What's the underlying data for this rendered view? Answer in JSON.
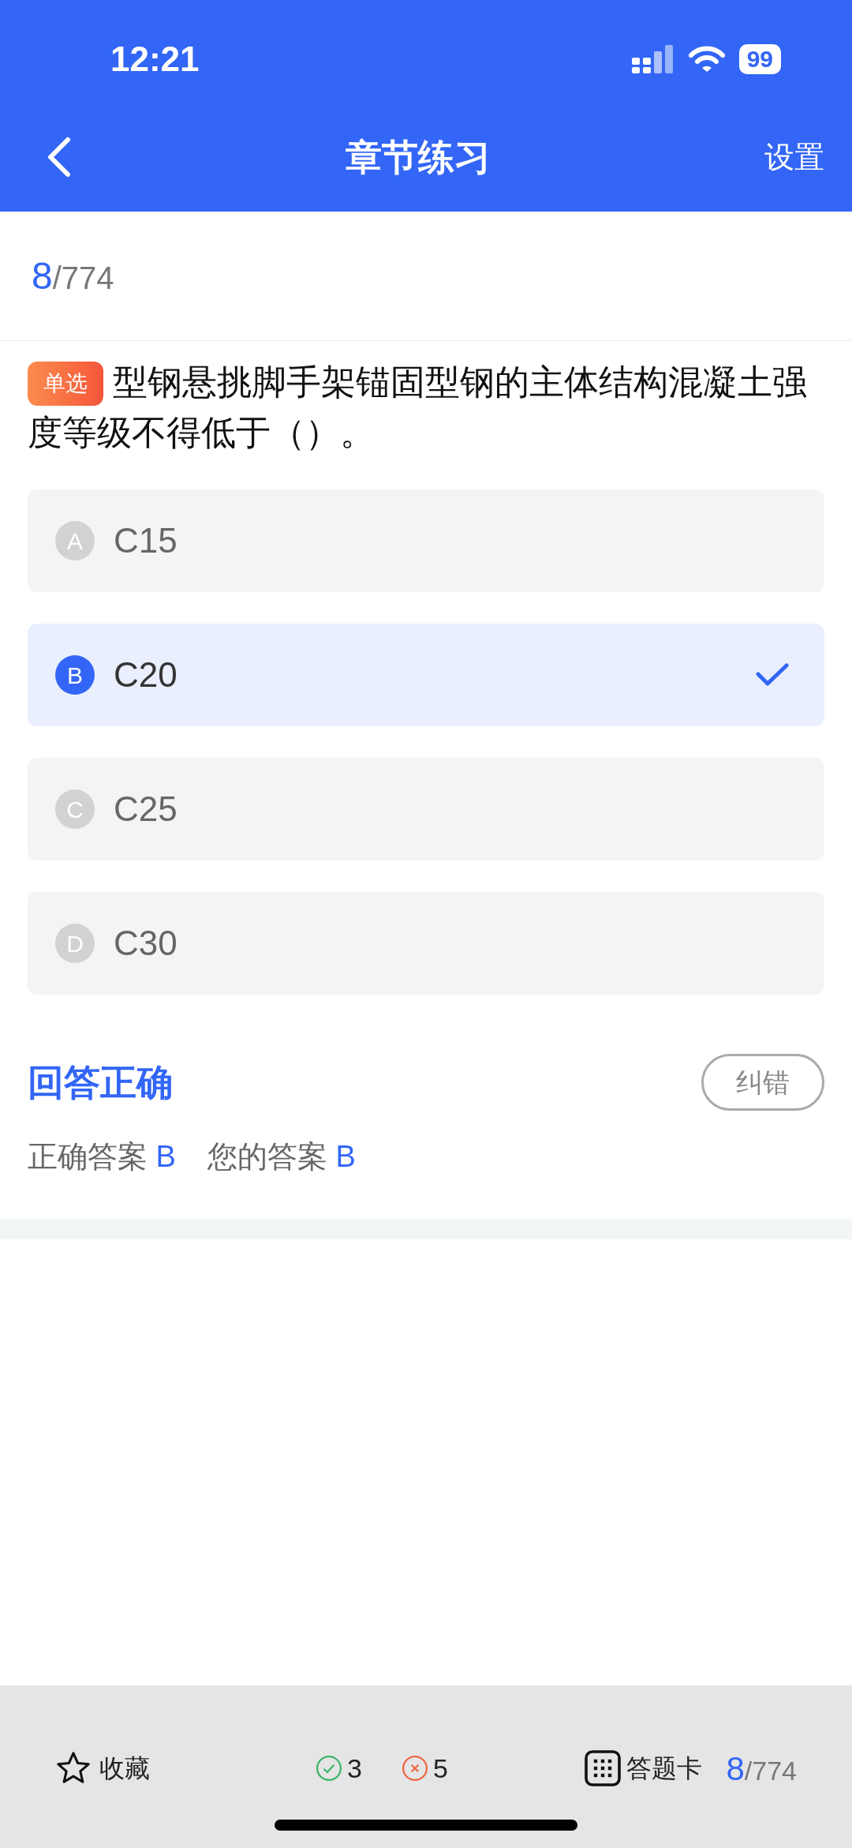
{
  "status_bar": {
    "time": "12:21",
    "battery": "99"
  },
  "nav": {
    "title": "章节练习",
    "action": "设置"
  },
  "progress": {
    "current": "8",
    "total": "/774"
  },
  "question": {
    "type_badge": "单选",
    "text": "型钢悬挑脚手架锚固型钢的主体结构混凝土强度等级不得低于（）。"
  },
  "options": [
    {
      "letter": "A",
      "text": "C15",
      "selected": false
    },
    {
      "letter": "B",
      "text": "C20",
      "selected": true
    },
    {
      "letter": "C",
      "text": "C25",
      "selected": false
    },
    {
      "letter": "D",
      "text": "C30",
      "selected": false
    }
  ],
  "result": {
    "title": "回答正确",
    "report_button": "纠错",
    "correct_label": "正确答案",
    "correct_value": "B",
    "your_label": "您的答案",
    "your_value": "B"
  },
  "bottom_bar": {
    "favorite": "收藏",
    "right_count": "3",
    "wrong_count": "5",
    "answer_card": "答题卡",
    "current": "8",
    "total": "/774"
  }
}
